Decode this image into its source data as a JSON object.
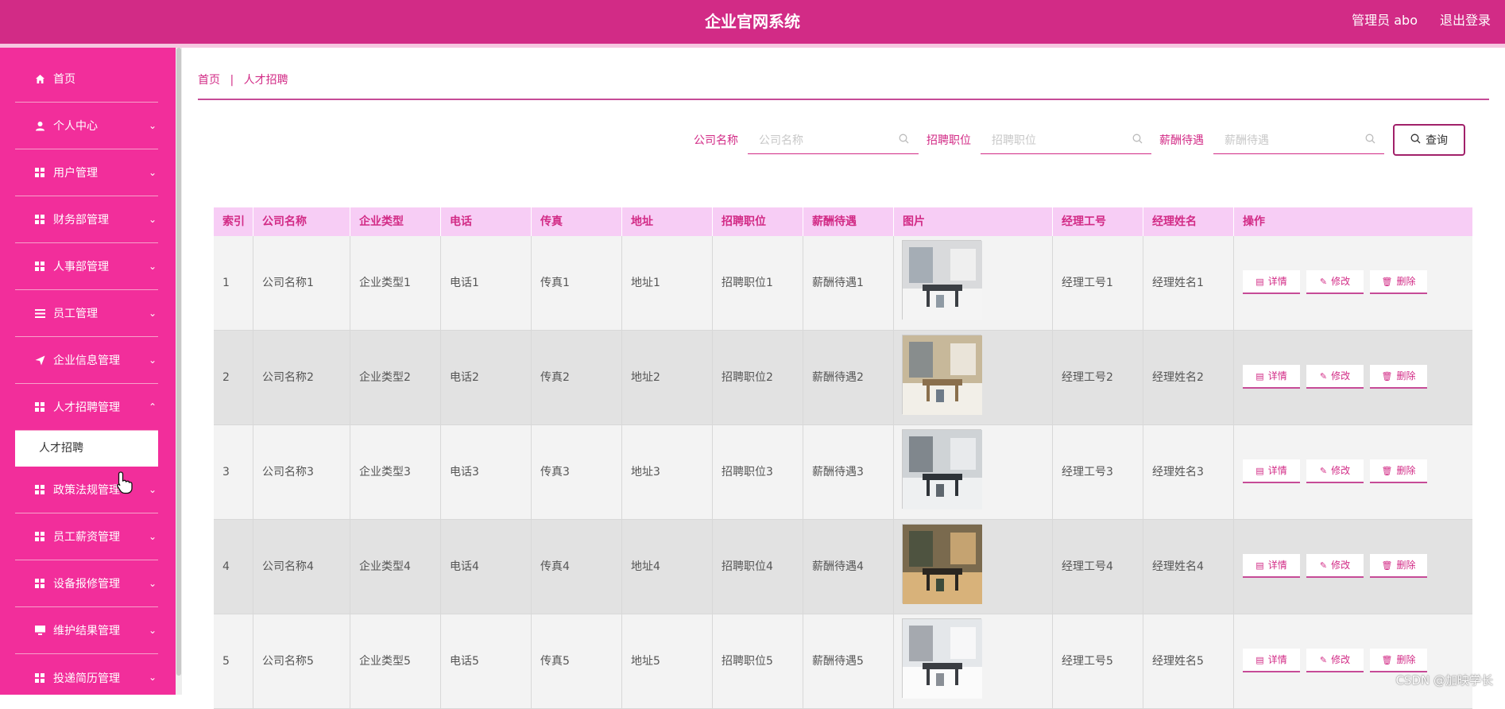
{
  "header": {
    "title": "企业官网系统",
    "user_label": "管理员 abo",
    "logout_label": "退出登录"
  },
  "sidebar": {
    "items": [
      {
        "label": "首页",
        "icon": "home-icon",
        "has_children": false
      },
      {
        "label": "个人中心",
        "icon": "user-icon",
        "has_children": true
      },
      {
        "label": "用户管理",
        "icon": "grid-icon",
        "has_children": true
      },
      {
        "label": "财务部管理",
        "icon": "grid-icon",
        "has_children": true
      },
      {
        "label": "人事部管理",
        "icon": "grid-icon",
        "has_children": true
      },
      {
        "label": "员工管理",
        "icon": "list-icon",
        "has_children": true
      },
      {
        "label": "企业信息管理",
        "icon": "send-icon",
        "has_children": true
      },
      {
        "label": "人才招聘管理",
        "icon": "grid-icon",
        "has_children": true,
        "expanded": true
      },
      {
        "label": "政策法规管理",
        "icon": "grid-icon",
        "has_children": true
      },
      {
        "label": "员工薪资管理",
        "icon": "grid-icon",
        "has_children": true
      },
      {
        "label": "设备报修管理",
        "icon": "grid-icon",
        "has_children": true
      },
      {
        "label": "维护结果管理",
        "icon": "monitor-icon",
        "has_children": true
      },
      {
        "label": "投递简历管理",
        "icon": "grid-icon",
        "has_children": true
      }
    ],
    "active_subitem": "人才招聘"
  },
  "breadcrumb": {
    "home": "首页",
    "separator": "|",
    "current": "人才招聘"
  },
  "search": {
    "company_label": "公司名称",
    "company_placeholder": "公司名称",
    "position_label": "招聘职位",
    "position_placeholder": "招聘职位",
    "salary_label": "薪酬待遇",
    "salary_placeholder": "薪酬待遇",
    "query_label": "查询"
  },
  "table": {
    "headers": [
      "索引",
      "公司名称",
      "企业类型",
      "电话",
      "传真",
      "地址",
      "招聘职位",
      "薪酬待遇",
      "图片",
      "经理工号",
      "经理姓名",
      "操作"
    ],
    "rows": [
      {
        "index": "1",
        "company": "公司名称1",
        "type": "企业类型1",
        "phone": "电话1",
        "fax": "传真1",
        "address": "地址1",
        "position": "招聘职位1",
        "salary": "薪酬待遇1",
        "manager_id": "经理工号1",
        "manager_name": "经理姓名1"
      },
      {
        "index": "2",
        "company": "公司名称2",
        "type": "企业类型2",
        "phone": "电话2",
        "fax": "传真2",
        "address": "地址2",
        "position": "招聘职位2",
        "salary": "薪酬待遇2",
        "manager_id": "经理工号2",
        "manager_name": "经理姓名2"
      },
      {
        "index": "3",
        "company": "公司名称3",
        "type": "企业类型3",
        "phone": "电话3",
        "fax": "传真3",
        "address": "地址3",
        "position": "招聘职位3",
        "salary": "薪酬待遇3",
        "manager_id": "经理工号3",
        "manager_name": "经理姓名3"
      },
      {
        "index": "4",
        "company": "公司名称4",
        "type": "企业类型4",
        "phone": "电话4",
        "fax": "传真4",
        "address": "地址4",
        "position": "招聘职位4",
        "salary": "薪酬待遇4",
        "manager_id": "经理工号4",
        "manager_name": "经理姓名4"
      },
      {
        "index": "5",
        "company": "公司名称5",
        "type": "企业类型5",
        "phone": "电话5",
        "fax": "传真5",
        "address": "地址5",
        "position": "招聘职位5",
        "salary": "薪酬待遇5",
        "manager_id": "经理工号5",
        "manager_name": "经理姓名5"
      }
    ],
    "actions": {
      "detail": "详情",
      "edit": "修改",
      "delete": "删除"
    }
  },
  "watermark": "CSDN @加映学长",
  "colors": {
    "header": "#d22b86",
    "sidebar": "#f22e9b",
    "accent": "#d22b86",
    "table_header": "#f7cdf5"
  }
}
